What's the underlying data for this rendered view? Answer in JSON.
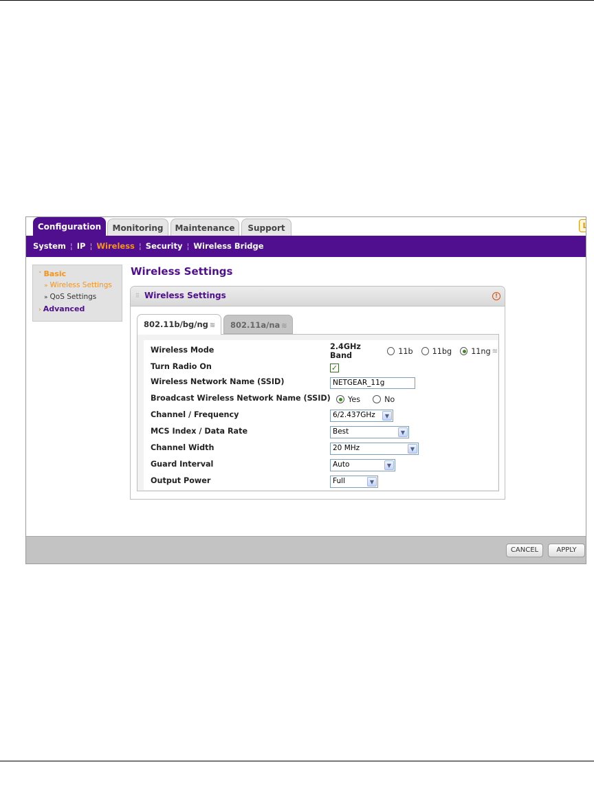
{
  "tabs": [
    {
      "label": "Configuration",
      "active": true
    },
    {
      "label": "Monitoring",
      "active": false
    },
    {
      "label": "Maintenance",
      "active": false
    },
    {
      "label": "Support",
      "active": false
    }
  ],
  "logout_glyph": "L",
  "subnav": [
    {
      "label": "System",
      "active": false
    },
    {
      "label": "IP",
      "active": false
    },
    {
      "label": "Wireless",
      "active": true
    },
    {
      "label": "Security",
      "active": false
    },
    {
      "label": "Wireless Bridge",
      "active": false
    }
  ],
  "sidebar": {
    "basic": "Basic",
    "basic_items": [
      "Wireless Settings",
      "QoS Settings"
    ],
    "advanced": "Advanced"
  },
  "main": {
    "title": "Wireless Settings",
    "panel_title": "Wireless Settings",
    "help_glyph": "!"
  },
  "band_tabs": [
    {
      "label": "802.11b/bg/ng",
      "active": true
    },
    {
      "label": "802.11a/na",
      "active": false
    }
  ],
  "form": {
    "wireless_mode": {
      "label": "Wireless Mode",
      "band": "2.4GHz Band",
      "options": [
        "11b",
        "11bg",
        "11ng"
      ],
      "selected": "11ng"
    },
    "radio_on": {
      "label": "Turn Radio On",
      "checked": true
    },
    "ssid": {
      "label": "Wireless Network Name (SSID)",
      "value": "NETGEAR_11g"
    },
    "broadcast": {
      "label": "Broadcast Wireless Network Name (SSID)",
      "options": [
        "Yes",
        "No"
      ],
      "selected": "Yes"
    },
    "channel": {
      "label": "Channel / Frequency",
      "value": "6/2.437GHz"
    },
    "mcs": {
      "label": "MCS Index / Data Rate",
      "value": "Best"
    },
    "width": {
      "label": "Channel Width",
      "value": "20 MHz"
    },
    "guard": {
      "label": "Guard Interval",
      "value": "Auto"
    },
    "power": {
      "label": "Output Power",
      "value": "Full"
    }
  },
  "footer": {
    "cancel": "CANCEL",
    "apply": "APPLY"
  },
  "colors": {
    "brand": "#4f0f8e",
    "accent": "#f7941d"
  }
}
